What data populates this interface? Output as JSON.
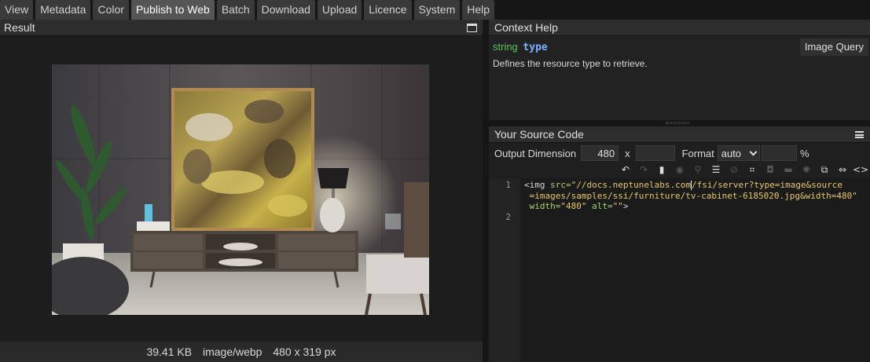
{
  "tabs": [
    {
      "label": "View"
    },
    {
      "label": "Metadata"
    },
    {
      "label": "Color"
    },
    {
      "label": "Publish to Web",
      "active": true
    },
    {
      "label": "Batch"
    },
    {
      "label": "Download"
    },
    {
      "label": "Upload"
    },
    {
      "label": "Licence"
    },
    {
      "label": "System"
    },
    {
      "label": "Help"
    }
  ],
  "result": {
    "title": "Result",
    "footer": {
      "size": "39.41 KB",
      "format": "image/webp",
      "dimensions": "480 x 319 px"
    }
  },
  "context_help": {
    "title": "Context Help",
    "param_kind": "string",
    "param_name": "type",
    "description": "Defines the resource type to retrieve.",
    "image_query_button": "Image Query"
  },
  "source_code": {
    "title": "Your Source Code",
    "output_dimension_label": "Output Dimension",
    "width_value": "480",
    "x_separator": "x",
    "height_value": "",
    "format_label": "Format",
    "format_value": "auto",
    "quality_value": "",
    "percent": "%",
    "line_numbers": [
      "1",
      "2"
    ],
    "code": {
      "tag_open": "<img",
      "src_attr": " src=",
      "src_value_a": "\"//docs.neptunelabs.com",
      "src_value_b": "/fsi/server?type=image&source",
      "src_value_c": "=images/samples/ssi/furniture/tv-cabinet-6185020.jpg&width=480\"",
      "width_attr": "width=",
      "width_val": "\"480\"",
      "alt_attr": " alt=",
      "alt_val": "\"\"",
      "tag_close": ">"
    }
  },
  "colors": {
    "accent_keyword": "#59c35a",
    "param_name": "#7ab0ff",
    "attr": "#a6d36b",
    "string": "#e6c76a"
  }
}
